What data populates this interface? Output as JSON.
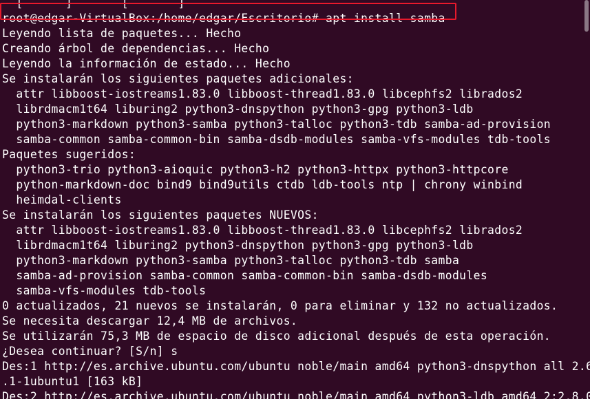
{
  "colors": {
    "background": "#300a24",
    "text": "#ffffff",
    "highlight_border": "#e8192c"
  },
  "terminal": {
    "lines": [
      "  [      ]       [       ]  ",
      "root@edgar-VirtualBox:/home/edgar/Escritorio# apt install samba",
      "Leyendo lista de paquetes... Hecho",
      "Creando árbol de dependencias... Hecho",
      "Leyendo la información de estado... Hecho",
      "Se instalarán los siguientes paquetes adicionales:",
      "  attr libboost-iostreams1.83.0 libboost-thread1.83.0 libcephfs2 librados2",
      "  librdmacm1t64 liburing2 python3-dnspython python3-gpg python3-ldb",
      "  python3-markdown python3-samba python3-talloc python3-tdb samba-ad-provision",
      "  samba-common samba-common-bin samba-dsdb-modules samba-vfs-modules tdb-tools",
      "Paquetes sugeridos:",
      "  python3-trio python3-aioquic python3-h2 python3-httpx python3-httpcore",
      "  python-markdown-doc bind9 bind9utils ctdb ldb-tools ntp | chrony winbind",
      "  heimdal-clients",
      "Se instalarán los siguientes paquetes NUEVOS:",
      "  attr libboost-iostreams1.83.0 libboost-thread1.83.0 libcephfs2 librados2",
      "  librdmacm1t64 liburing2 python3-dnspython python3-gpg python3-ldb",
      "  python3-markdown python3-samba python3-talloc python3-tdb samba",
      "  samba-ad-provision samba-common samba-common-bin samba-dsdb-modules",
      "  samba-vfs-modules tdb-tools",
      "0 actualizados, 21 nuevos se instalarán, 0 para eliminar y 132 no actualizados.",
      "Se necesita descargar 12,4 MB de archivos.",
      "Se utilizarán 75,3 MB de espacio de disco adicional después de esta operación.",
      "¿Desea continuar? [S/n] s",
      "Des:1 http://es.archive.ubuntu.com/ubuntu noble/main amd64 python3-dnspython all 2.6",
      ".1-1ubuntu1 [163 kB]",
      "Des:2 http://es.archive.ubuntu.com/ubuntu noble/main amd64 python3-ldb amd64 2:2.8.0"
    ]
  }
}
